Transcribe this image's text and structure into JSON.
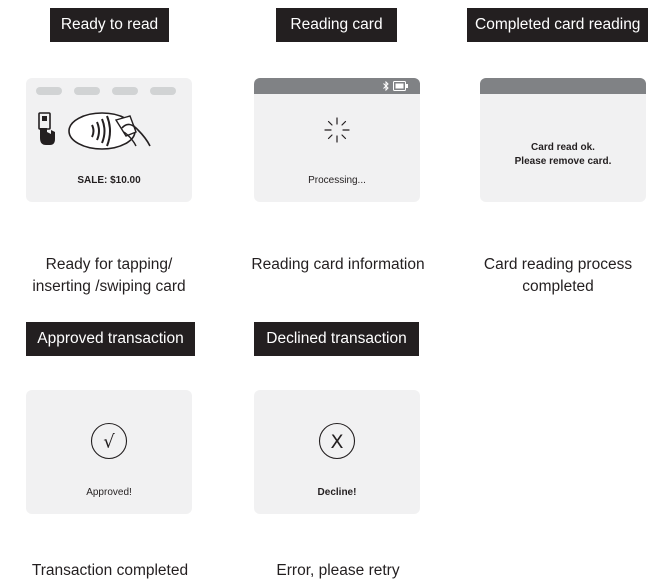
{
  "panels": {
    "ready": {
      "label": "Ready to read",
      "screen_text": "SALE:  $10.00",
      "caption_line1": "Ready for tapping/",
      "caption_line2": "inserting /swiping card"
    },
    "reading": {
      "label": "Reading card",
      "screen_text": "Processing...",
      "caption": "Reading card information"
    },
    "completed": {
      "label": "Completed card reading",
      "screen_line1": "Card read ok.",
      "screen_line2": "Please remove card.",
      "caption_line1": "Card reading process",
      "caption_line2": "completed"
    },
    "approved": {
      "label": "Approved transaction",
      "icon_glyph": "√",
      "screen_text": "Approved!",
      "caption": "Transaction completed"
    },
    "declined": {
      "label": "Declined transaction",
      "icon_glyph": "X",
      "screen_text": "Decline!",
      "caption": "Error, please retry"
    }
  },
  "colors": {
    "label_bg": "#231f20",
    "screen_bg": "#f1f1f2",
    "status_bar": "#808285"
  }
}
